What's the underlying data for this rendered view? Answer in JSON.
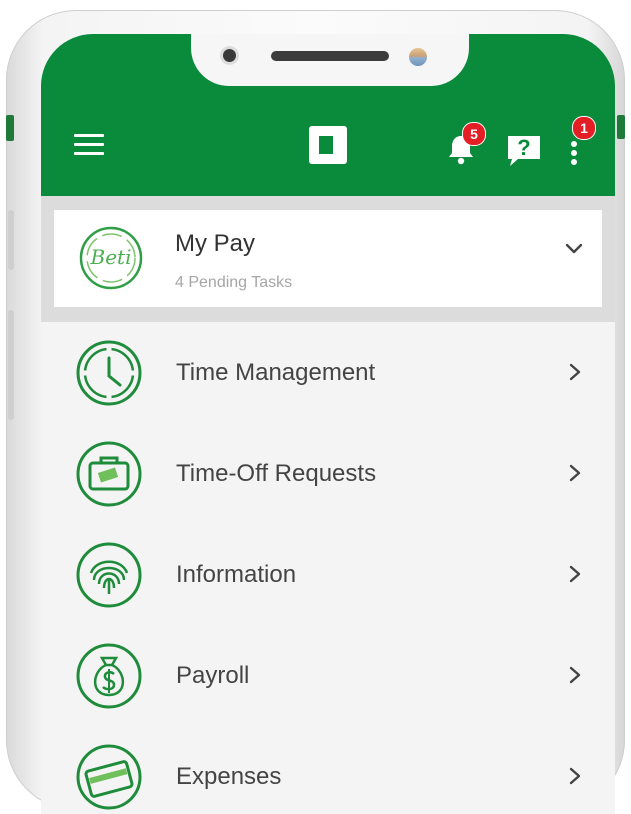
{
  "header": {
    "notifications_count": "5",
    "more_count": "1",
    "help_glyph": "?",
    "brand_color": "#0a8a3b",
    "badge_color": "#e31e24"
  },
  "mypay": {
    "logo_text": "Beti",
    "title": "My Pay",
    "subtitle": "4 Pending Tasks"
  },
  "menu": [
    {
      "label": "Time Management",
      "icon": "clock-icon"
    },
    {
      "label": "Time-Off Requests",
      "icon": "suitcase-icon"
    },
    {
      "label": "Information",
      "icon": "fingerprint-icon"
    },
    {
      "label": "Payroll",
      "icon": "money-bag-icon"
    },
    {
      "label": "Expenses",
      "icon": "credit-card-icon"
    }
  ]
}
